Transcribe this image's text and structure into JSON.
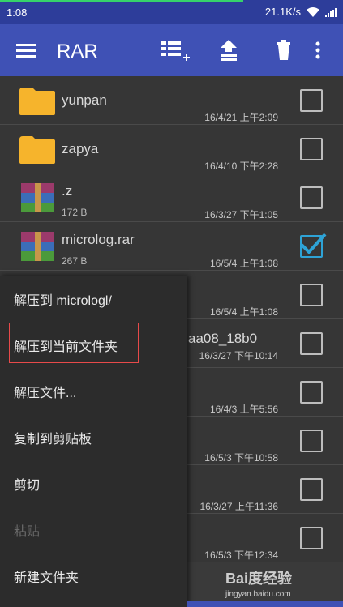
{
  "status": {
    "time": "1:08",
    "speed": "21.1K/s"
  },
  "toolbar": {
    "title": "RAR"
  },
  "files": [
    {
      "name": "yunpan",
      "size": "",
      "date": "16/4/21 上午2:09",
      "type": "folder",
      "checked": false
    },
    {
      "name": "zapya",
      "size": "",
      "date": "16/4/10 下午2:28",
      "type": "folder",
      "checked": false
    },
    {
      "name": ".z",
      "size": "172 B",
      "date": "16/3/27 下午1:05",
      "type": "archive",
      "checked": false
    },
    {
      "name": "microlog.rar",
      "size": "267 B",
      "date": "16/5/4 上午1:08",
      "type": "archive",
      "checked": true
    },
    {
      "name": "",
      "size": "",
      "date": "16/5/4 上午1:08",
      "type": "archive",
      "checked": false
    },
    {
      "name": "aa08_18b0",
      "size": "",
      "date": "16/3/27 下午10:14",
      "type": "archive",
      "checked": false
    },
    {
      "name": "",
      "size": "",
      "date": "16/4/3 上午5:56",
      "type": "archive",
      "checked": false
    },
    {
      "name": "",
      "size": "",
      "date": "16/5/3 下午10:58",
      "type": "archive",
      "checked": false
    },
    {
      "name": "",
      "size": "",
      "date": "16/3/27 上午11:36",
      "type": "archive",
      "checked": false
    },
    {
      "name": "",
      "size": "",
      "date": "16/5/3 下午12:34",
      "type": "archive",
      "checked": false
    }
  ],
  "menu": {
    "items": [
      {
        "label": "解压到 micrologl/",
        "disabled": false
      },
      {
        "label": "解压到当前文件夹",
        "disabled": false
      },
      {
        "label": "解压文件...",
        "disabled": false
      },
      {
        "label": "复制到剪贴板",
        "disabled": false
      },
      {
        "label": "剪切",
        "disabled": false
      },
      {
        "label": "粘贴",
        "disabled": true
      },
      {
        "label": "新建文件夹",
        "disabled": false
      }
    ]
  },
  "watermark": {
    "brand": "Bai度经验",
    "url": "jingyan.baidu.com"
  },
  "colors": {
    "toolbar": "#3f51b5",
    "status": "#2d3d9a",
    "check": "#2ea3d6",
    "highlight": "#e84a4a"
  }
}
